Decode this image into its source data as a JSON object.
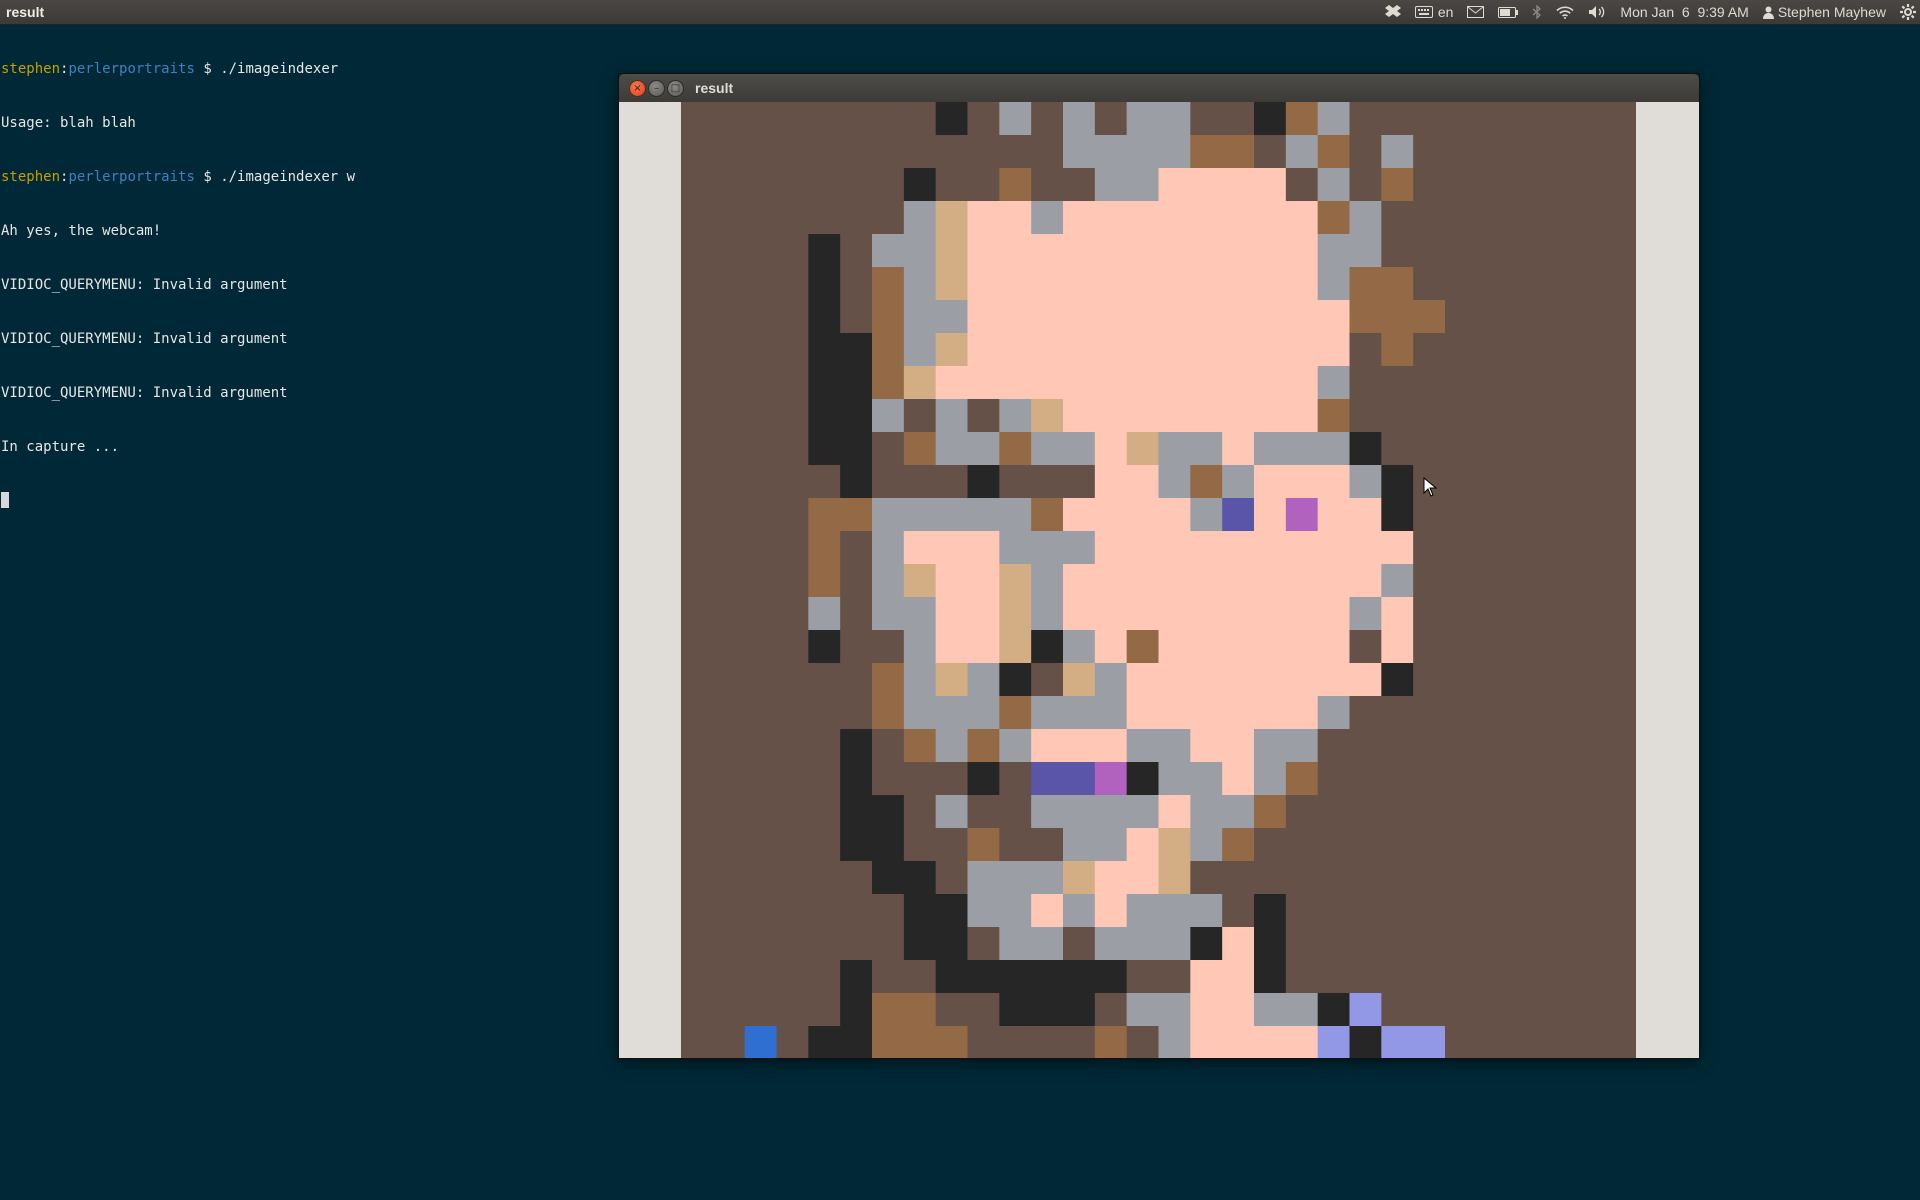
{
  "topbar": {
    "app_title": "result",
    "keyboard_layout": "en",
    "datetime": "Mon Jan  6  9:39 AM",
    "user_name": "Stephen Mayhew",
    "icons": [
      "dropbox-icon",
      "keyboard-icon",
      "mail-icon",
      "battery-icon",
      "bluetooth-icon",
      "wifi-icon",
      "volume-icon",
      "user-icon",
      "gear-icon"
    ]
  },
  "terminal": {
    "lines": [
      {
        "user": "stephen",
        "sep": ":",
        "dir": "perlerportraits",
        "prompt": " $ ",
        "cmd": "./imageindexer"
      },
      {
        "text": "Usage: blah blah"
      },
      {
        "user": "stephen",
        "sep": ":",
        "dir": "perlerportraits",
        "prompt": " $ ",
        "cmd": "./imageindexer w"
      },
      {
        "text": "Ah yes, the webcam!"
      },
      {
        "text": "VIDIOC_QUERYMENU: Invalid argument"
      },
      {
        "text": "VIDIOC_QUERYMENU: Invalid argument"
      },
      {
        "text": "VIDIOC_QUERYMENU: Invalid argument"
      },
      {
        "text": "In capture ..."
      }
    ]
  },
  "window": {
    "title": "result",
    "buttons": {
      "close": "×",
      "minimize": "–",
      "maximize": "□"
    }
  },
  "portrait": {
    "palette": {
      "B": "#665149",
      "K": "#262626",
      "G": "#9b9fa5",
      "O": "#936a45",
      "T": "#d3ad84",
      "P": "#ffc8b6",
      "I": "#5b55a9",
      "V": "#b161be",
      "L": "#9398e6",
      "U": "#2f6fd2",
      "W": "#e0dcd8"
    },
    "rows": [
      "BBBBBBBBKBGBGBGGBBKOGBBBBBBBBB",
      "BBBBBBBBBBBBGGGGOOBGOBGBBBBBBB",
      "BBBBBBBKBBOBBGGPPPPBGBOBBBBBBB",
      "BBBBBBBGTPPGPPPPPPPPOGBBBBBBBB",
      "BBBBKBGGTPPPPPPPPPPPGGBBBBBBBB",
      "BBBBKBOGTPPPPPPPPPPPGOOBBBBBBB",
      "BBBBKBOGGPPPPPPPPPPPPOOOBBBBBB",
      "BBBBKKOGTPPPPPPPPPPPPBOBBBBBBB",
      "BBBBKKOTPPPPPPPPPPPPGBBBBBBBBB",
      "BBBBKKGBGBGTPPPPPPPPOBBBBBBBBB",
      "BBBBKKBOGGOGGPTGGPGGGKBBBBBBBB",
      "BBBBBKBBBKBBBPPGOGPPPGKBBBBBBB",
      "BBBBOOGGGGGOPPPPGIPVPPKBBBBBBB",
      "BBBBOBGPPPGGGPPPPPPPPPPBBBBBBB",
      "BBBBOBGTPPTGPPPPPPPPPPGBBBBBBB",
      "BBBBGBGGPPTGPPPPPPPPPGPBBBBBBB",
      "BBBBKBBGPPTKGPOPPPPPPBPBBBBBBB",
      "BBBBBBOGTGKBTGPPPPPPPPKBBBBBBB",
      "BBBBBBOGGGOGGGPPPPPPGBBBBBBBBB",
      "BBBBBKBOGOGPPPGGPPGGBBBBBBBBBB",
      "BBBBBKBBBKBIIVKGGPGOBBBBBBBBBB",
      "BBBBBKKBGBBGGGGPGGOBBBBBBBBBBB",
      "BBBBBKKBBOBBGGPTGOBBBBBBBBBBBB",
      "BBBBBBKKBGGGTPPTBBBBBBBBBBBBBB",
      "BBBBBBBKKGGPGPGGGBKBBBBBBBBBBB",
      "BBBBBBBKKBGGBGGGKPKBBBBBBBBBBB",
      "BBBBBKBBKKKKKKBBPPKBBBBBBBBBBB",
      "BBBBBKOOBBKKKBGGPPGGKLBBBBBBBB",
      "BBUBKKOOOBBBBOBGPPPPLKLLBBBBBB"
    ]
  }
}
